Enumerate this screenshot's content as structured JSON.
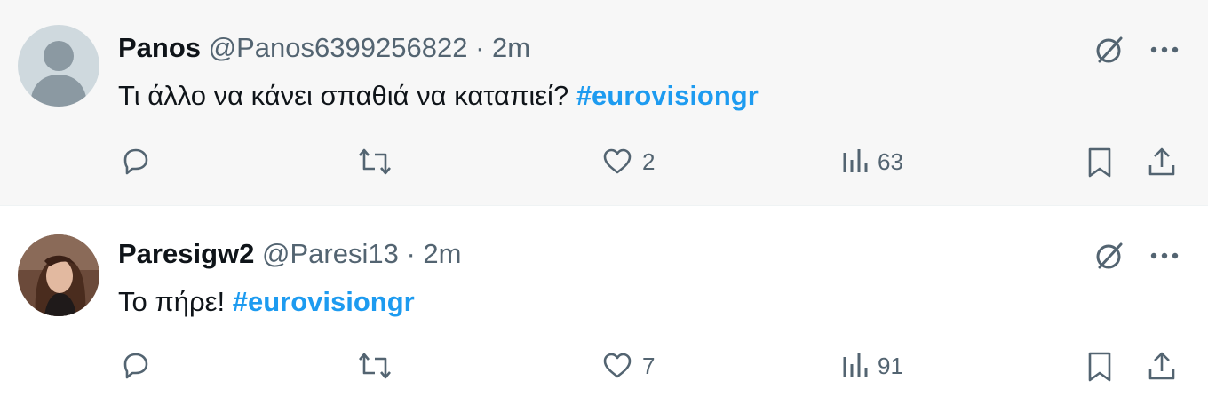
{
  "tweets": [
    {
      "name": "Panos",
      "handle": "@Panos6399256822",
      "separator": "·",
      "time": "2m",
      "text": "Τι άλλο να κάνει σπαθιά να καταπιεί?",
      "hashtag": "#eurovisiongr",
      "stats": {
        "replies": "",
        "retweets": "",
        "likes": "2",
        "views": "63"
      },
      "avatar": "default-avatar"
    },
    {
      "name": "Paresigw2",
      "handle": "@Paresi13",
      "separator": "·",
      "time": "2m",
      "text": "Το πήρε!",
      "hashtag": "#eurovisiongr",
      "stats": {
        "replies": "",
        "retweets": "",
        "likes": "7",
        "views": "91"
      },
      "avatar": "profile-photo"
    }
  ],
  "colors": {
    "text": "#0f1419",
    "muted": "#536471",
    "link": "#1d9bf0",
    "highlight_bg": "#f7f7f7"
  },
  "icons": [
    "reply-icon",
    "retweet-icon",
    "like-icon",
    "views-icon",
    "bookmark-icon",
    "share-icon",
    "grok-icon",
    "more-icon"
  ]
}
